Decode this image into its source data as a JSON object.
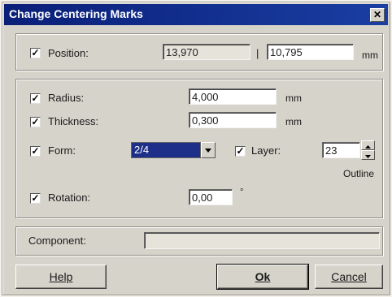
{
  "window": {
    "title": "Change Centering Marks",
    "close_glyph": "✕"
  },
  "position": {
    "label": "Position:",
    "checked": "✓",
    "x": "13,970",
    "separator": "|",
    "y": "10,795",
    "unit": "mm"
  },
  "radius": {
    "label": "Radius:",
    "checked": "✓",
    "value": "4,000",
    "unit": "mm"
  },
  "thickness": {
    "label": "Thickness:",
    "checked": "✓",
    "value": "0,300",
    "unit": "mm"
  },
  "form": {
    "label": "Form:",
    "checked": "✓",
    "value": "2/4"
  },
  "layer": {
    "label": "Layer:",
    "checked": "✓",
    "value": "23",
    "name": "Outline"
  },
  "rotation": {
    "label": "Rotation:",
    "checked": "✓",
    "value": "0,00",
    "unit": "°"
  },
  "component": {
    "label": "Component:",
    "value": ""
  },
  "buttons": {
    "help": "Help",
    "ok": "Ok",
    "cancel": "Cancel"
  },
  "icons": {
    "dropdown": "chevron-down-icon",
    "spin_up": "up-arrow-icon",
    "spin_down": "down-arrow-icon",
    "close": "close-icon"
  }
}
